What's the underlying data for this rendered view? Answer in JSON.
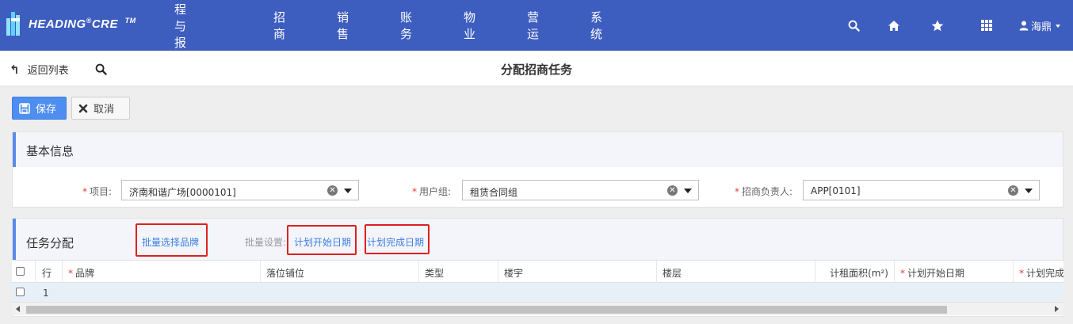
{
  "app": {
    "logo_text": "HEADING",
    "logo_reg": "®",
    "logo_suffix": "CRE",
    "logo_tm": "TM"
  },
  "nav": {
    "items": [
      "流程与报表",
      "招商",
      "销售",
      "账务",
      "物业",
      "营运",
      "系统"
    ]
  },
  "top_icons": [
    "search-icon",
    "home-icon",
    "star-icon",
    "apps-grid-icon"
  ],
  "user": {
    "name": "海鼎"
  },
  "subheader": {
    "back_label": "返回列表",
    "title": "分配招商任务"
  },
  "toolbar": {
    "save_label": "保存",
    "cancel_label": "取消"
  },
  "basic": {
    "title": "基本信息",
    "fields": [
      {
        "label": "项目:",
        "required": true,
        "value": "济南和谐广场[0000101]"
      },
      {
        "label": "用户组:",
        "required": true,
        "value": "租赁合同组"
      },
      {
        "label": "招商负责人:",
        "required": true,
        "value": "APP[0101]"
      }
    ]
  },
  "task": {
    "title": "任务分配",
    "batch_select_brand": "批量选择品牌",
    "batch_setting_label": "批量设置:",
    "plan_start_date": "计划开始日期",
    "plan_finish_date": "计划完成日期"
  },
  "table": {
    "columns": [
      "行",
      "品牌",
      "落位铺位",
      "类型",
      "楼宇",
      "楼层",
      "计租面积(m²)",
      "计划开始日期",
      "计划完成"
    ],
    "required_columns": [
      "品牌",
      "计划开始日期",
      "计划完成"
    ],
    "rows": [
      {
        "row": "1"
      }
    ]
  },
  "colors": {
    "topbar": "#3d5dbf",
    "accent": "#4e8ef0",
    "highlight_box": "#e02020",
    "required": "#e23b3b"
  }
}
